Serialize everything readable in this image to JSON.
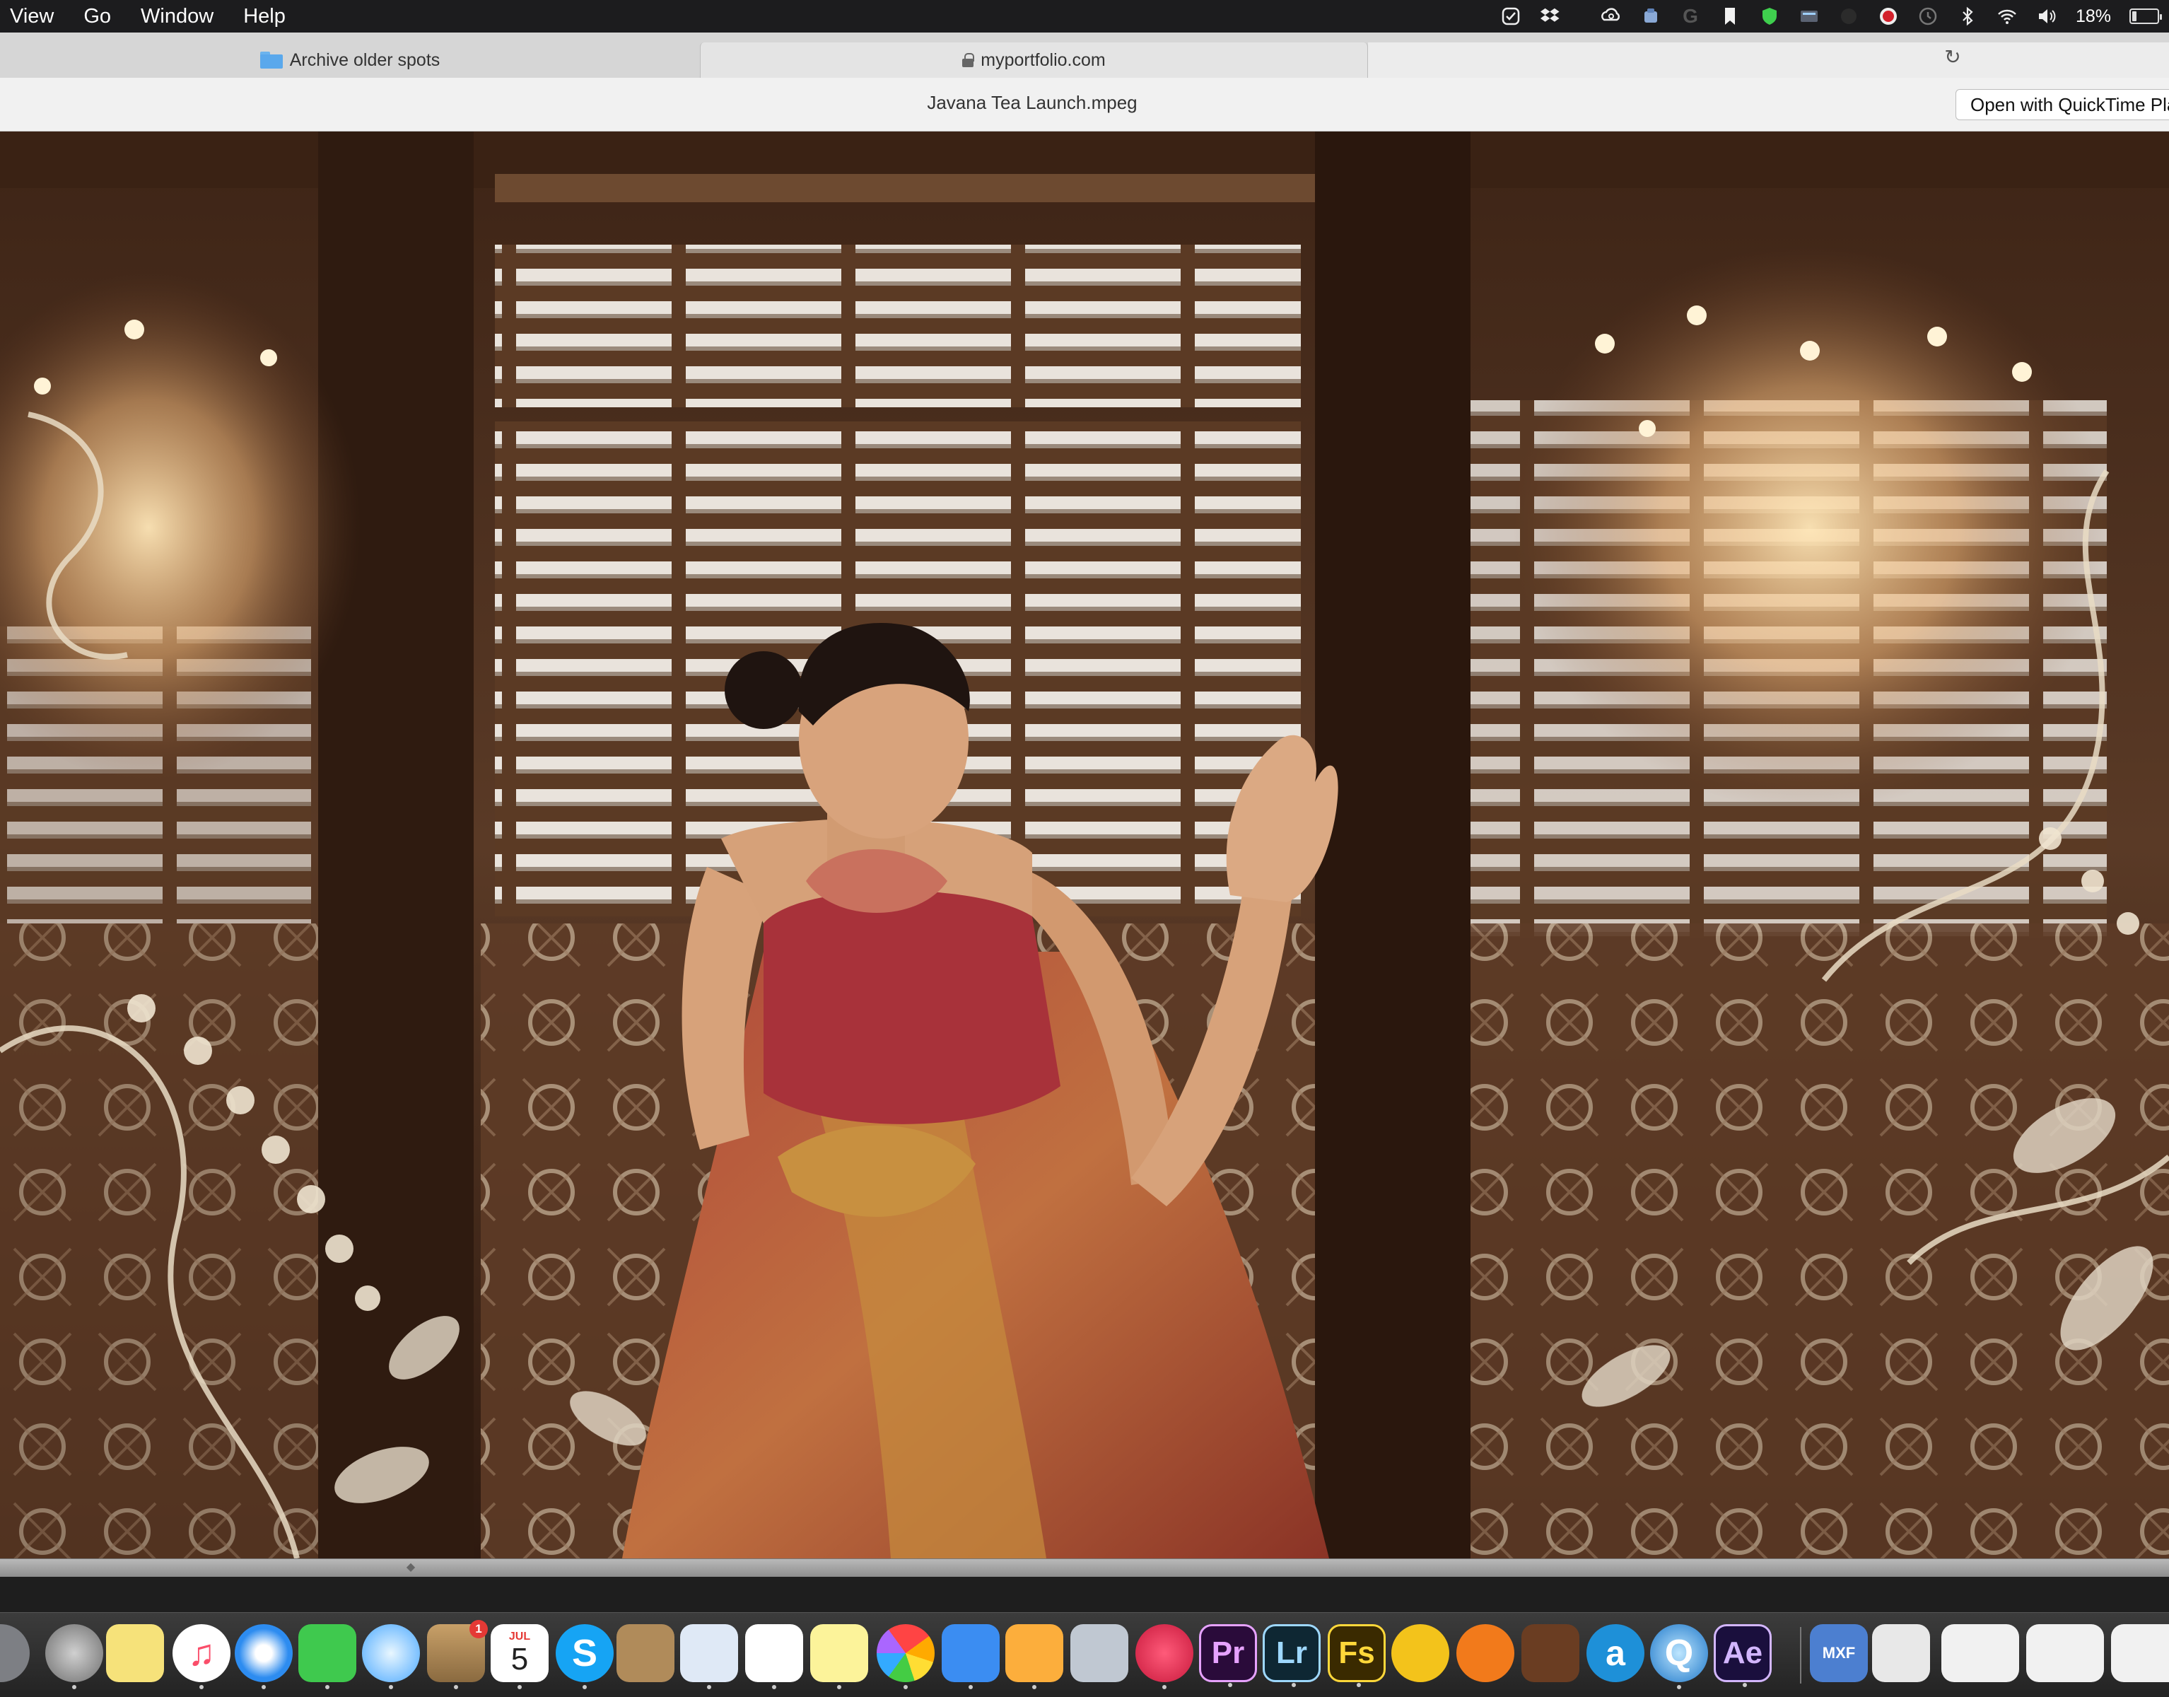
{
  "menubar": {
    "items": [
      "View",
      "Go",
      "Window",
      "Help"
    ],
    "battery_text": "18%",
    "battery_level": 0.18,
    "status_icons": [
      "task-check-icon",
      "dropbox-icon",
      "creative-cloud-icon",
      "drive-icon",
      "grammarly-icon",
      "bookmark-icon",
      "shield-icon",
      "display-icon",
      "record-icon",
      "time-machine-icon",
      "bluetooth-icon",
      "wifi-icon",
      "volume-icon",
      "battery-icon"
    ]
  },
  "browser": {
    "tabs": [
      {
        "label": "Archive older spots",
        "icon": "folder-icon"
      },
      {
        "label": "myportfolio.com",
        "icon": "lock-icon"
      }
    ],
    "reload_icon": "reload-icon"
  },
  "viewer": {
    "file_title": "Javana Tea Launch.mpeg",
    "open_button": "Open with QuickTime Player"
  },
  "video": {
    "description_colors": {
      "wood": "#4a2d1c",
      "dress": "#9a3a2a",
      "gold": "#c8873a",
      "ornament": "#e9dcc4"
    }
  },
  "dock": {
    "calendar_month": "JUL",
    "calendar_day": "5",
    "mail_badge": "1",
    "apps": [
      {
        "name": "launchpad-icon",
        "label": ""
      },
      {
        "name": "system-preferences-icon",
        "label": ""
      },
      {
        "name": "stickies-icon",
        "label": ""
      },
      {
        "name": "itunes-icon",
        "label": "♫"
      },
      {
        "name": "safari-icon",
        "label": ""
      },
      {
        "name": "facetime-icon",
        "label": ""
      },
      {
        "name": "messages-icon",
        "label": ""
      },
      {
        "name": "mail-icon",
        "label": ""
      },
      {
        "name": "calendar-icon",
        "label": ""
      },
      {
        "name": "skype-icon",
        "label": "S"
      },
      {
        "name": "contacts-icon",
        "label": ""
      },
      {
        "name": "preview-icon",
        "label": ""
      },
      {
        "name": "reminders-icon",
        "label": ""
      },
      {
        "name": "notes-icon",
        "label": ""
      },
      {
        "name": "photos-icon",
        "label": ""
      },
      {
        "name": "keynote-icon",
        "label": ""
      },
      {
        "name": "pages-icon",
        "label": ""
      },
      {
        "name": "image-capture-icon",
        "label": ""
      },
      {
        "name": "davinci-resolve-icon",
        "label": ""
      },
      {
        "name": "premiere-pro-icon",
        "label": "Pr"
      },
      {
        "name": "lightroom-icon",
        "label": "Lr"
      },
      {
        "name": "fuse-icon",
        "label": "Fs"
      },
      {
        "name": "lynda-icon",
        "label": ""
      },
      {
        "name": "clapper-icon",
        "label": ""
      },
      {
        "name": "garageband-icon",
        "label": ""
      },
      {
        "name": "amazon-drive-icon",
        "label": "a"
      },
      {
        "name": "quicktime-icon",
        "label": "Q"
      },
      {
        "name": "after-effects-icon",
        "label": "Ae"
      },
      {
        "name": "mxf-icon",
        "label": "MXF"
      },
      {
        "name": "document-icon",
        "label": ""
      },
      {
        "name": "window-thumbnail-1-icon",
        "label": ""
      },
      {
        "name": "window-thumbnail-2-icon",
        "label": ""
      },
      {
        "name": "window-thumbnail-3-icon",
        "label": ""
      }
    ]
  }
}
